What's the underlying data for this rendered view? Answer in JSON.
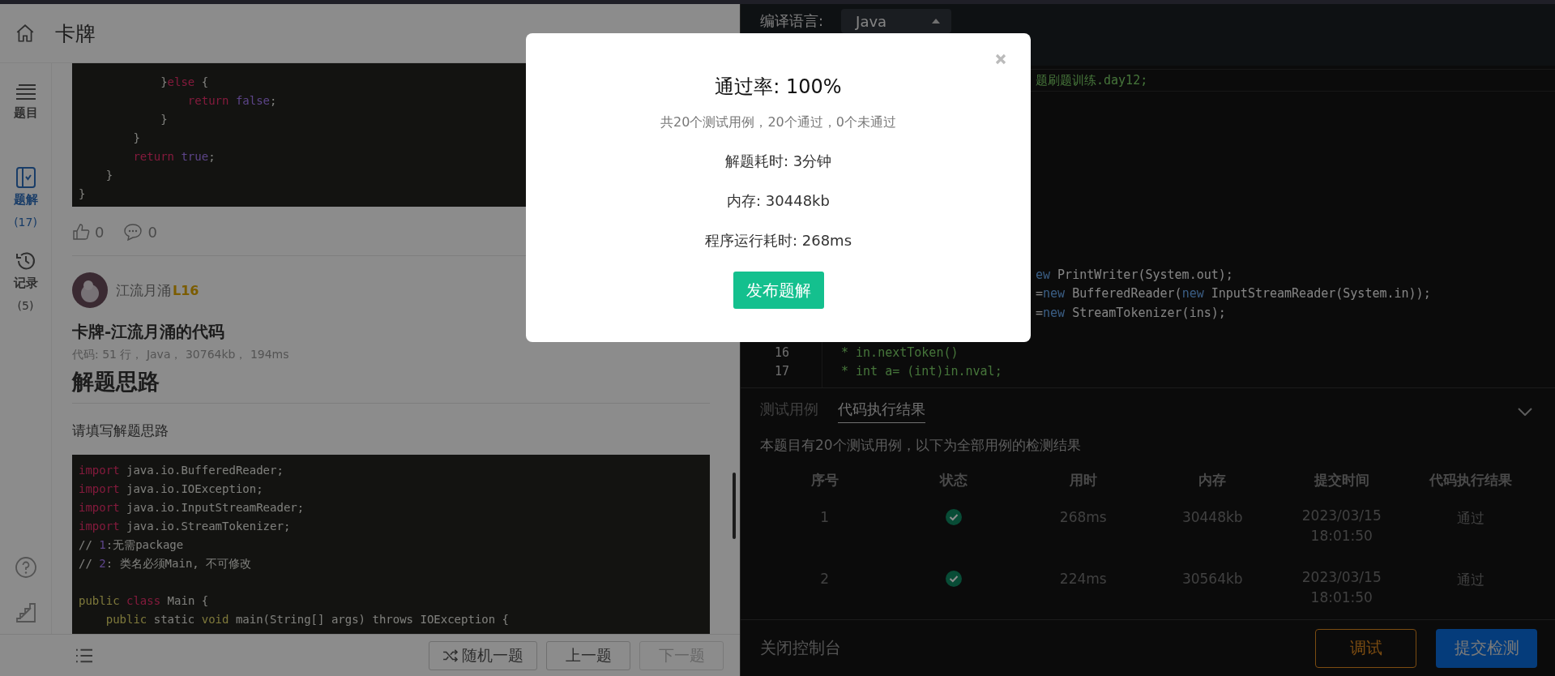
{
  "header": {
    "title": "卡牌"
  },
  "sidebar": {
    "items": [
      {
        "kind": "list",
        "label": "题目",
        "selected": false
      },
      {
        "kind": "book",
        "label": "题解",
        "count": "(17)",
        "selected": true
      },
      {
        "kind": "history",
        "label": "记录",
        "count": "(5)",
        "selected": false
      }
    ]
  },
  "prev_code": {
    "lines": [
      {
        "segs": [
          {
            "kind": "p",
            "t": "            }"
          },
          {
            "kind": "kw",
            "t": "else"
          },
          {
            "kind": "p",
            "t": " {"
          }
        ]
      },
      {
        "segs": [
          {
            "kind": "kw",
            "t": "                return "
          },
          {
            "kind": "lit",
            "t": "false"
          },
          {
            "kind": "p",
            "t": ";"
          }
        ]
      },
      {
        "segs": [
          {
            "kind": "p",
            "t": "            }"
          }
        ]
      },
      {
        "segs": [
          {
            "kind": "p",
            "t": "        }"
          }
        ]
      },
      {
        "segs": [
          {
            "kind": "kw",
            "t": "        return "
          },
          {
            "kind": "lit",
            "t": "true"
          },
          {
            "kind": "p",
            "t": ";"
          }
        ]
      },
      {
        "segs": [
          {
            "kind": "p",
            "t": "    }"
          }
        ]
      },
      {
        "segs": [
          {
            "kind": "p",
            "t": "}"
          }
        ]
      }
    ]
  },
  "reactions": {
    "likes": "0",
    "comments": "0"
  },
  "author": {
    "name": "江流月涌",
    "level": "L16"
  },
  "post": {
    "title": "卡牌-江流月涌的代码",
    "meta": "代码: 51 行， Java， 30764kb， 194ms",
    "heading": "解题思路",
    "body": "请填写解题思路",
    "code": [
      [
        {
          "segs": [
            {
              "kind": "kw",
              "t": "import "
            },
            {
              "kind": "p",
              "t": "java.io.BufferedReader;"
            }
          ]
        },
        {
          "segs": [
            {
              "kind": "kw",
              "t": "import "
            },
            {
              "kind": "p",
              "t": "java.io.IOException;"
            }
          ]
        },
        {
          "segs": [
            {
              "kind": "kw",
              "t": "import "
            },
            {
              "kind": "p",
              "t": "java.io.InputStreamReader;"
            }
          ]
        },
        {
          "segs": [
            {
              "kind": "kw",
              "t": "import "
            },
            {
              "kind": "p",
              "t": "java.io.StreamTokenizer;"
            }
          ]
        },
        {
          "segs": [
            {
              "kind": "p",
              "t": "// "
            },
            {
              "kind": "lit",
              "t": "1"
            },
            {
              "kind": "p",
              "t": ":无需package"
            }
          ]
        },
        {
          "segs": [
            {
              "kind": "p",
              "t": "// "
            },
            {
              "kind": "lit",
              "t": "2"
            },
            {
              "kind": "p",
              "t": ": 类名必须Main, 不可修改"
            }
          ]
        }
      ],
      [
        {
          "segs": [
            {
              "kind": "ty",
              "t": "public "
            },
            {
              "kind": "kw",
              "t": "class "
            },
            {
              "kind": "p",
              "t": "Main {"
            }
          ]
        },
        {
          "segs": [
            {
              "kind": "ty",
              "t": "    public "
            },
            {
              "kind": "p",
              "t": "static "
            },
            {
              "kind": "ty",
              "t": "void "
            },
            {
              "kind": "p",
              "t": "main(String[] args) throws IOException {"
            }
          ]
        }
      ]
    ]
  },
  "bottom_bar": {
    "buttons": [
      {
        "kind": "random",
        "label": "随机一题",
        "disabled": false
      },
      {
        "kind": "plain",
        "label": "上一题",
        "disabled": false
      },
      {
        "kind": "plain",
        "label": "下一题",
        "disabled": true
      }
    ]
  },
  "editor": {
    "language_label": "编译语言:",
    "language": "Java",
    "top_lines": [
      {
        "clipped": true,
        "segs": [
          {
            "kind": "cm",
            "t": "题刷题训练.day12;"
          }
        ]
      }
    ],
    "middle_lines": [
      {
        "clipped": true,
        "segs": [
          {
            "kind": "new",
            "t": "ew "
          },
          {
            "kind": "p",
            "t": "PrintWriter(System.out);"
          }
        ]
      },
      {
        "clipped": true,
        "segs": [
          {
            "kind": "p",
            "t": "="
          },
          {
            "kind": "new",
            "t": "new "
          },
          {
            "kind": "p",
            "t": "BufferedReader("
          },
          {
            "kind": "new",
            "t": "new "
          },
          {
            "kind": "p",
            "t": "InputStreamReader(System.in));"
          }
        ]
      },
      {
        "clipped": true,
        "segs": [
          {
            "kind": "p",
            "t": "="
          },
          {
            "kind": "new",
            "t": "new "
          },
          {
            "kind": "p",
            "t": "StreamTokenizer(ins);"
          }
        ]
      }
    ],
    "bottom_lines": [
      {
        "num": "16",
        "segs": [
          {
            "kind": "cm",
            "t": "* in.nextToken()"
          }
        ]
      },
      {
        "num": "17",
        "segs": [
          {
            "kind": "cm",
            "t": "* int a= (int)in.nval;"
          }
        ]
      }
    ]
  },
  "console": {
    "tabs": [
      {
        "label": "测试用例",
        "selected": false
      },
      {
        "label": "代码执行结果",
        "selected": true
      }
    ],
    "summary": "本题目有20个测试用例，以下为全部用例的检测结果",
    "table": {
      "columns": [
        "序号",
        "状态",
        "用时",
        "内存",
        "提交时间",
        "代码执行结果"
      ],
      "rows": [
        {
          "index": "1",
          "passed": true,
          "time": "268ms",
          "memory": "30448kb",
          "submitted": "2023/03/15 18:01:50",
          "result": "通过"
        },
        {
          "index": "2",
          "passed": true,
          "time": "224ms",
          "memory": "30564kb",
          "submitted": "2023/03/15 18:01:50",
          "result": "通过"
        }
      ]
    }
  },
  "footer": {
    "close_label": "关闭控制台",
    "buttons": [
      {
        "kind": "outline",
        "label": "调试"
      },
      {
        "kind": "primary",
        "label": "提交检测"
      }
    ]
  },
  "modal": {
    "title": "通过率: 100%",
    "summary": "共20个测试用例，20个通过，0个未通过",
    "stats": [
      "解题耗时: 3分钟",
      "内存: 30448kb",
      "程序运行耗时: 268ms"
    ],
    "button": "发布题解"
  }
}
